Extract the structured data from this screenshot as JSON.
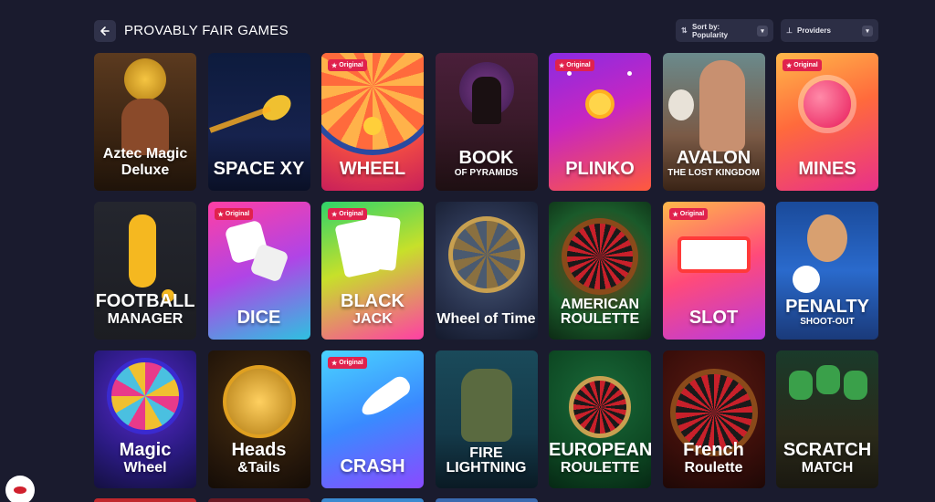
{
  "header": {
    "title": "PROVABLY FAIR GAMES",
    "sort_label": "Sort by: Popularity",
    "providers_label": "Providers"
  },
  "badge_text": "Original",
  "games": [
    {
      "name": "Aztec Magic",
      "sub": "Deluxe",
      "original": false,
      "bg": "linear-gradient(180deg,#5b3a1f 0%,#3a2412 60%,#1f1309 100%)"
    },
    {
      "name": "SPACE XY",
      "original": false,
      "bg": "linear-gradient(180deg,#0d1b3d 0%,#16224d 60%,#0a1026 100%)"
    },
    {
      "name": "WHEEL",
      "original": true,
      "bg": "radial-gradient(circle at 50% 20%,#ffb24a 0%,#ff5a3c 45%,#c81f5a 100%)"
    },
    {
      "name": "BOOK",
      "sub": "OF PYRAMIDS",
      "original": false,
      "bg": "linear-gradient(180deg,#4a1f3a 0%,#3a1a2a 50%,#1e0f12 100%)"
    },
    {
      "name": "PLINKO",
      "original": true,
      "bg": "linear-gradient(160deg,#8a2be2 0%,#c726c1 45%,#ff5a3c 100%)"
    },
    {
      "name": "AVALON",
      "sub": "THE LOST KINGDOM",
      "original": false,
      "bg": "linear-gradient(180deg,#6a8a8c 0%,#7a5a46 60%,#3a2416 100%)"
    },
    {
      "name": "MINES",
      "original": true,
      "bg": "linear-gradient(160deg,#ffb84a 0%,#ff6a3c 45%,#e8308a 100%)"
    },
    {
      "name": "FOOTBALL",
      "sub": "MANAGER",
      "original": false,
      "bg": "linear-gradient(180deg,#24262e 0%,#1c1d22 100%)"
    },
    {
      "name": "DICE",
      "original": true,
      "bg": "linear-gradient(160deg,#ff3fa4 0%,#b044e6 50%,#2ec1e0 100%)"
    },
    {
      "name": "BLACK",
      "sub": "JACK",
      "original": true,
      "bg": "linear-gradient(160deg,#2fd36a 0%,#c7e02a 45%,#ff3fa4 100%)"
    },
    {
      "name": "Wheel of Time",
      "original": false,
      "bg": "radial-gradient(circle at 50% 45%,#4a5a78 0%,#2a3450 55%,#141a2c 100%)"
    },
    {
      "name": "AMERICAN ROULETTE",
      "original": false,
      "bg": "radial-gradient(circle at 50% 45%,#8a3a12 0%,#1a5a2a 60%,#0c2a14 100%)"
    },
    {
      "name": "SLOT",
      "original": true,
      "bg": "linear-gradient(160deg,#ffb84a 0%,#ff4a7a 50%,#b83ae0 100%)"
    },
    {
      "name": "PENALTY",
      "sub": "SHOOT-OUT",
      "original": false,
      "bg": "linear-gradient(180deg,#1a4a9a 0%,#2a6acc 50%,#1a3a7a 100%)"
    },
    {
      "name": "Magic",
      "sub": "Wheel",
      "original": false,
      "bg": "radial-gradient(circle at 50% 35%,#5a2ad0 0%,#2a1a80 60%,#141040 100%)"
    },
    {
      "name": "Heads",
      "sub": "&Tails",
      "original": false,
      "bg": "radial-gradient(circle at 50% 40%,#4a3010 0%,#24160a 70%,#140c06 100%)"
    },
    {
      "name": "CRASH",
      "original": true,
      "bg": "linear-gradient(160deg,#4ad4ff 0%,#3a8aff 50%,#8a4aff 100%)"
    },
    {
      "name": "FIRE LIGHTNING",
      "original": false,
      "bg": "linear-gradient(180deg,#1a4a5a 0%,#143a4a 60%,#0a1a24 100%)"
    },
    {
      "name": "EUROPEAN",
      "sub": "ROULETTE",
      "original": false,
      "bg": "radial-gradient(circle at 50% 35%,#1a6a3a 0%,#0e4a24 60%,#062814 100%)"
    },
    {
      "name": "French",
      "sub": "Roulette",
      "original": false,
      "bg": "radial-gradient(circle at 50% 35%,#5a1a12 0%,#3a0e0a 60%,#1e0806 100%)"
    },
    {
      "name": "SCRATCH",
      "sub": "MATCH",
      "original": false,
      "bg": "linear-gradient(180deg,#1a3a2a 0%,#2a2a1a 60%,#1a1810 100%)"
    }
  ],
  "partial_colors": [
    "#c0282c",
    "#6a1a24",
    "#3a8ad0",
    "#3a6ab0"
  ],
  "colors": {
    "background": "#1a1b2e",
    "badge": "#e0224d",
    "control": "#2c2e45"
  }
}
